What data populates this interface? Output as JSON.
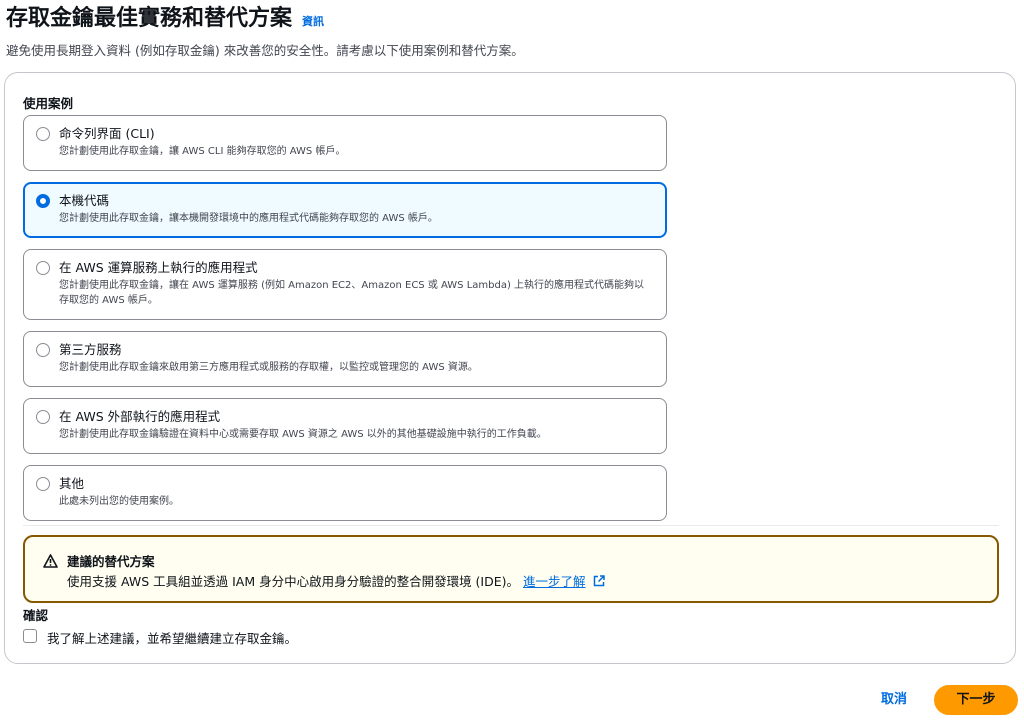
{
  "header": {
    "title": "存取金鑰最佳實務和替代方案",
    "info_link": "資訊",
    "description": "避免使用長期登入資料 (例如存取金鑰) 來改善您的安全性。請考慮以下使用案例和替代方案。"
  },
  "use_cases": {
    "label": "使用案例",
    "selected": "本機代碼",
    "options": [
      {
        "label": "命令列界面 (CLI)",
        "description": "您計劃使用此存取金鑰，讓 AWS CLI 能夠存取您的 AWS 帳戶。"
      },
      {
        "label": "本機代碼",
        "description": "您計劃使用此存取金鑰，讓本機開發環境中的應用程式代碼能夠存取您的 AWS 帳戶。"
      },
      {
        "label": "在 AWS 運算服務上執行的應用程式",
        "description": "您計劃使用此存取金鑰，讓在 AWS 運算服務 (例如 Amazon EC2、Amazon ECS 或 AWS Lambda) 上執行的應用程式代碼能夠以存取您的 AWS 帳戶。"
      },
      {
        "label": "第三方服務",
        "description": "您計劃使用此存取金鑰來啟用第三方應用程式或服務的存取權，以監控或管理您的 AWS 資源。"
      },
      {
        "label": "在 AWS 外部執行的應用程式",
        "description": "您計劃使用此存取金鑰驗證在資料中心或需要存取 AWS 資源之 AWS 以外的其他基礎設施中執行的工作負載。"
      },
      {
        "label": "其他",
        "description": "此處未列出您的使用案例。"
      }
    ]
  },
  "alert": {
    "icon": "warning-icon",
    "title": "建議的替代方案",
    "body": "使用支援 AWS 工具組並透過 IAM 身分中心啟用身分驗證的整合開發環境 (IDE)。",
    "link": "進一步了解",
    "link_icon": "external-link-icon",
    "border_color": "#855900",
    "background": "#fffef0"
  },
  "confirm": {
    "label": "確認",
    "checkbox_label": "我了解上述建議，並希望繼續建立存取金鑰。",
    "checked": false
  },
  "footer": {
    "cancel": "取消",
    "next": "下一步",
    "primary_color": "#ff9900"
  },
  "accent_color": "#006ce0"
}
